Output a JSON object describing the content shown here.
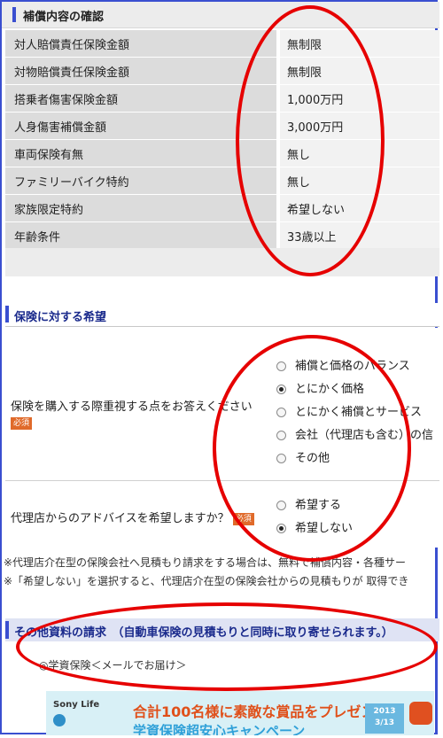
{
  "coverage": {
    "title": "補償内容の確認",
    "rows": [
      {
        "label": "対人賠償責任保険金額",
        "value": "無制限"
      },
      {
        "label": "対物賠償責任保険金額",
        "value": "無制限"
      },
      {
        "label": "搭乗者傷害保険金額",
        "value": "1,000万円"
      },
      {
        "label": "人身傷害補償金額",
        "value": "3,000万円"
      },
      {
        "label": "車両保険有無",
        "value": "無し"
      },
      {
        "label": "ファミリーバイク特約",
        "value": "無し"
      },
      {
        "label": "家族限定特約",
        "value": "希望しない"
      },
      {
        "label": "年齢条件",
        "value": "33歳以上"
      }
    ]
  },
  "preferences": {
    "title": "保険に対する希望",
    "required_badge": "必須",
    "q1": {
      "label": "保険を購入する際重視する点をお答えください",
      "options": [
        {
          "label": "補償と価格のバランス",
          "checked": false
        },
        {
          "label": "とにかく価格",
          "checked": true
        },
        {
          "label": "とにかく補償とサービス",
          "checked": false
        },
        {
          "label": "会社（代理店も含む）の信",
          "checked": false
        },
        {
          "label": "その他",
          "checked": false
        }
      ]
    },
    "q2": {
      "label": "代理店からのアドバイスを希望しますか？",
      "options": [
        {
          "label": "希望する",
          "checked": false
        },
        {
          "label": "希望しない",
          "checked": true
        }
      ]
    },
    "notes": [
      "※代理店介在型の保険会社へ見積もり請求をする場合は、無料で補償内容・各種サー",
      "※「希望しない」を選択すると、代理店介在型の保険会社からの見積もりが 取得でき"
    ]
  },
  "other_docs": {
    "title": "その他資料の請求　（自動車保険の見積もりと同時に取り寄せられます。）",
    "item": "◎学資保険＜メールでお届け＞"
  },
  "banner": {
    "logo": "Sony Life",
    "headline": "合計100名様に素敵な賞品をプレゼント!",
    "sub": "学資保険超安心キャンペーン",
    "date": "2013\n3/13"
  }
}
